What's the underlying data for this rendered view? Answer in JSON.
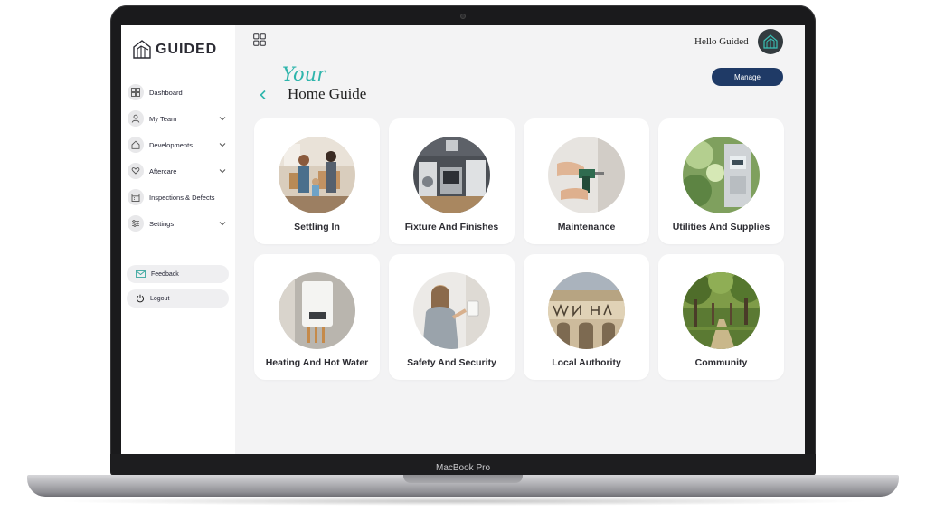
{
  "device": {
    "label": "MacBook Pro"
  },
  "sidebar": {
    "logo_text": "GUIDED",
    "items": [
      {
        "label": "Dashboard",
        "icon": "dashboard-icon",
        "has_chevron": false
      },
      {
        "label": "My Team",
        "icon": "person-icon",
        "has_chevron": true
      },
      {
        "label": "Developments",
        "icon": "home-icon",
        "has_chevron": true
      },
      {
        "label": "Aftercare",
        "icon": "heart-hand-icon",
        "has_chevron": true
      },
      {
        "label": "Inspections & Defects",
        "icon": "calendar-icon",
        "has_chevron": false
      },
      {
        "label": "Settings",
        "icon": "sliders-icon",
        "has_chevron": true
      }
    ],
    "feedback_label": "Feedback",
    "logout_label": "Logout"
  },
  "header": {
    "greeting": "Hello Guided",
    "title_script": "Your",
    "title": "Home Guide",
    "manage_label": "Manage"
  },
  "cards": [
    {
      "label": "Settling In",
      "image": "family-moving-boxes"
    },
    {
      "label": "Fixture And Finishes",
      "image": "modern-kitchen-appliances"
    },
    {
      "label": "Maintenance",
      "image": "hands-with-drill"
    },
    {
      "label": "Utilities And Supplies",
      "image": "utility-meter"
    },
    {
      "label": "Heating And Hot Water",
      "image": "boiler"
    },
    {
      "label": "Safety And Security",
      "image": "woman-at-alarm-panel"
    },
    {
      "label": "Local Authority",
      "image": "town-hall-building"
    },
    {
      "label": "Community",
      "image": "tree-lined-park"
    }
  ],
  "colors": {
    "accent_teal": "#2fb5ac",
    "navy_button": "#1f3a66",
    "screen_bg": "#f3f3f4"
  }
}
